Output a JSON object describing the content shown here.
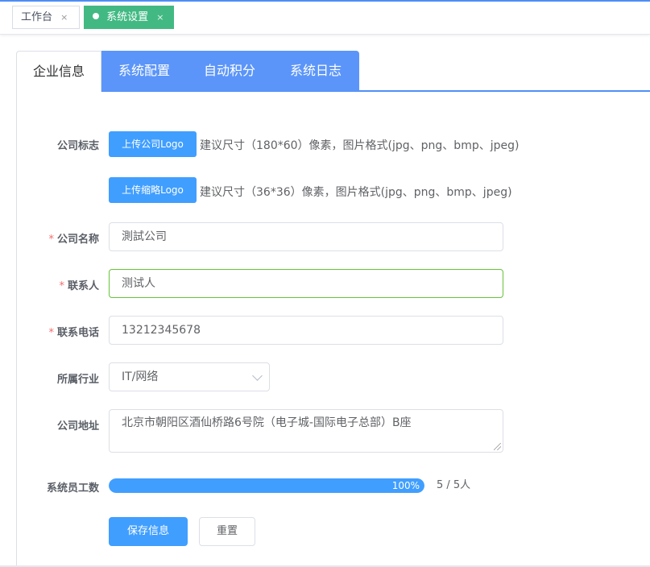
{
  "tags": [
    {
      "label": "工作台",
      "close": "×"
    },
    {
      "label": "系统设置",
      "close": "×"
    }
  ],
  "tabs": [
    "企业信息",
    "系统配置",
    "自动积分",
    "系统日志"
  ],
  "form": {
    "logo_label": "公司标志",
    "upload_logo_button": "上传公司Logo",
    "upload_logo_hint": "建议尺寸（180*60）像素，图片格式(jpg、png、bmp、jpeg)",
    "upload_thumb_button": "上传缩略Logo",
    "upload_thumb_hint": "建议尺寸（36*36）像素，图片格式(jpg、png、bmp、jpeg)",
    "company_name_label": "公司名称",
    "company_name_value": "測試公司",
    "contact_label": "联系人",
    "contact_value": "测试人",
    "phone_label": "联系电话",
    "phone_value": "13212345678",
    "industry_label": "所属行业",
    "industry_value": "IT/网络",
    "address_label": "公司地址",
    "address_value": "北京市朝阳区酒仙桥路6号院（电子城-国际电子总部）B座",
    "staff_label": "系统员工数",
    "staff_progress_text": "100%",
    "staff_progress_fraction": 1.0,
    "staff_count": "5 / 5人",
    "required_mark": "*",
    "save_button": "保存信息",
    "reset_button": "重置"
  },
  "colors": {
    "primary": "#409eff",
    "tab_bar": "#5b95f9",
    "active_tag": "#42b983",
    "focus_border": "#67c23a",
    "required": "#f56c6c"
  }
}
